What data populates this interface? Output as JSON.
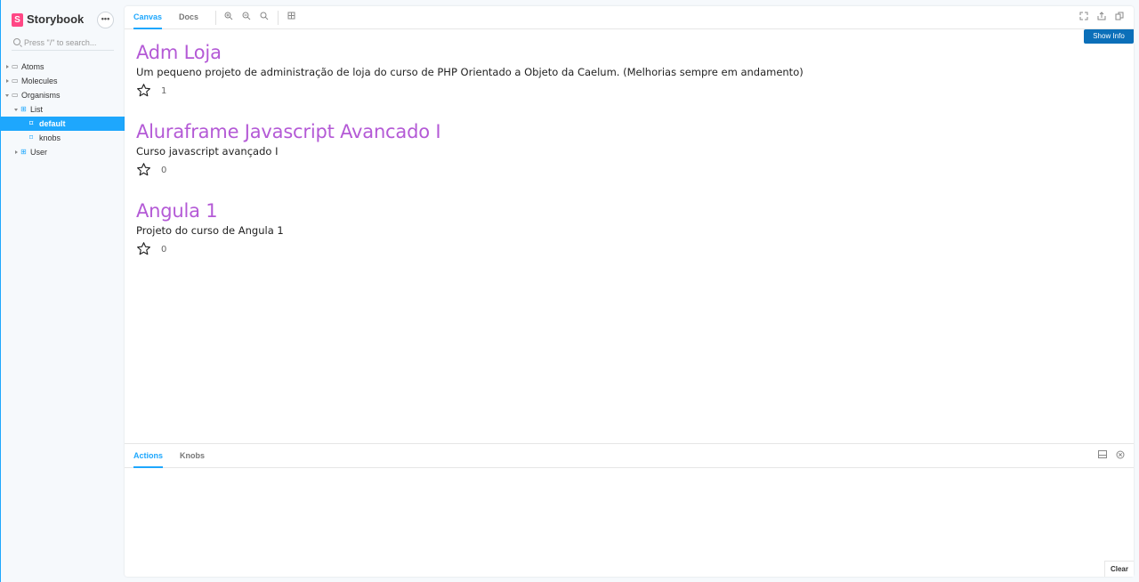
{
  "brand": {
    "logo_letter": "S",
    "name": "Storybook",
    "menu_glyph": "•••"
  },
  "search": {
    "placeholder": "Press \"/\" to search..."
  },
  "tree": {
    "atoms": "Atoms",
    "molecules": "Molecules",
    "organisms": "Organisms",
    "list": "List",
    "default": "default",
    "knobs": "knobs",
    "user": "User"
  },
  "toolbar": {
    "tab_canvas": "Canvas",
    "tab_docs": "Docs",
    "show_info": "Show Info"
  },
  "projects": [
    {
      "title": "Adm Loja",
      "description": "Um pequeno projeto de administração de loja do curso de PHP Orientado a Objeto da Caelum. (Melhorias sempre em andamento)",
      "stars": "1"
    },
    {
      "title": "Aluraframe Javascript Avancado I",
      "description": "Curso javascript avançado I",
      "stars": "0"
    },
    {
      "title": "Angula 1",
      "description": "Projeto do curso de Angula 1",
      "stars": "0"
    }
  ],
  "addons": {
    "tab_actions": "Actions",
    "tab_knobs": "Knobs",
    "clear_label": "Clear"
  },
  "colors": {
    "accent": "#1ea7fd",
    "brand": "#ff4785",
    "title": "#b45ad6",
    "show_info_bg": "#0b6fb9"
  },
  "icons": {
    "zoom_in": "zoom-in-icon",
    "zoom_out": "zoom-out-icon",
    "zoom_reset": "zoom-reset-icon",
    "background": "grid-icon",
    "fullscreen": "fullscreen-icon",
    "share": "share-icon",
    "copy": "copy-icon",
    "star": "star-icon"
  }
}
